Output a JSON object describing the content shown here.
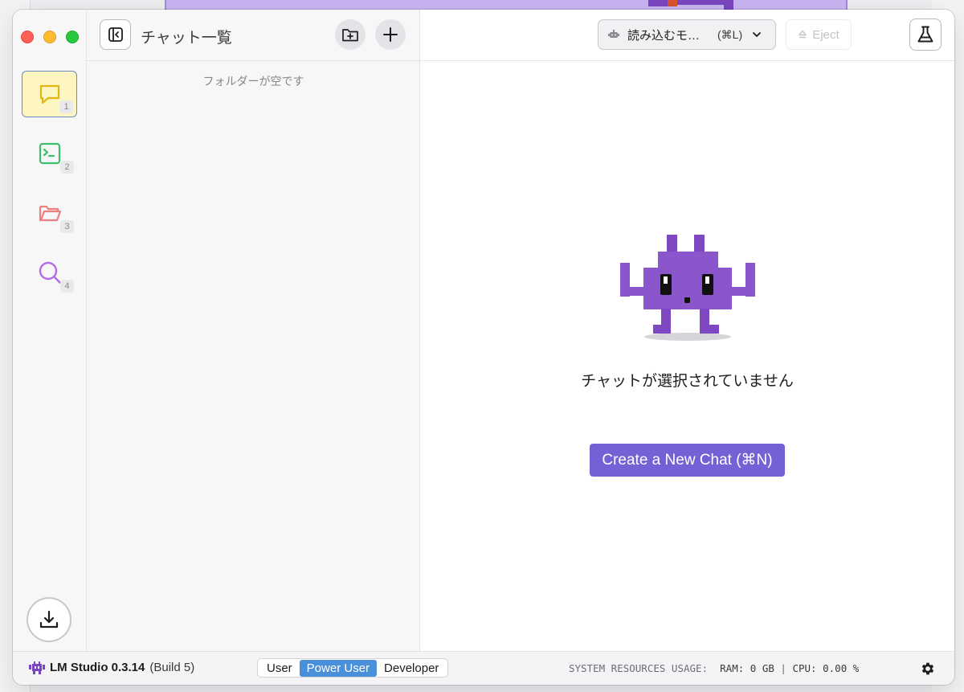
{
  "panel": {
    "title": "チャット一覧",
    "empty_note": "フォルダーが空です"
  },
  "rail": {
    "items": [
      {
        "num": "1",
        "icon": "chat-icon",
        "color": "#e2b714"
      },
      {
        "num": "2",
        "icon": "terminal-icon",
        "color": "#3fbf6e"
      },
      {
        "num": "3",
        "icon": "folder-icon",
        "color": "#ee7f7f"
      },
      {
        "num": "4",
        "icon": "search-icon",
        "color": "#b46be6"
      }
    ]
  },
  "header": {
    "model_select_label": "読み込むモ…",
    "model_select_shortcut": "(⌘L)",
    "eject_label": "Eject"
  },
  "main": {
    "empty_title": "チャットが選択されていません",
    "create_button": "Create a New Chat (⌘N)"
  },
  "status": {
    "app_name": "LM Studio 0.3.14",
    "build": "(Build 5)",
    "modes": [
      "User",
      "Power User",
      "Developer"
    ],
    "active_mode": "Power User",
    "resources_label": "SYSTEM RESOURCES USAGE:",
    "ram": "RAM: 0 GB",
    "separator": "|",
    "cpu": "CPU: 0.00 %"
  },
  "colors": {
    "accent": "#7560d6",
    "active_mode": "#4a90d9",
    "mascot": "#8b55cc"
  }
}
